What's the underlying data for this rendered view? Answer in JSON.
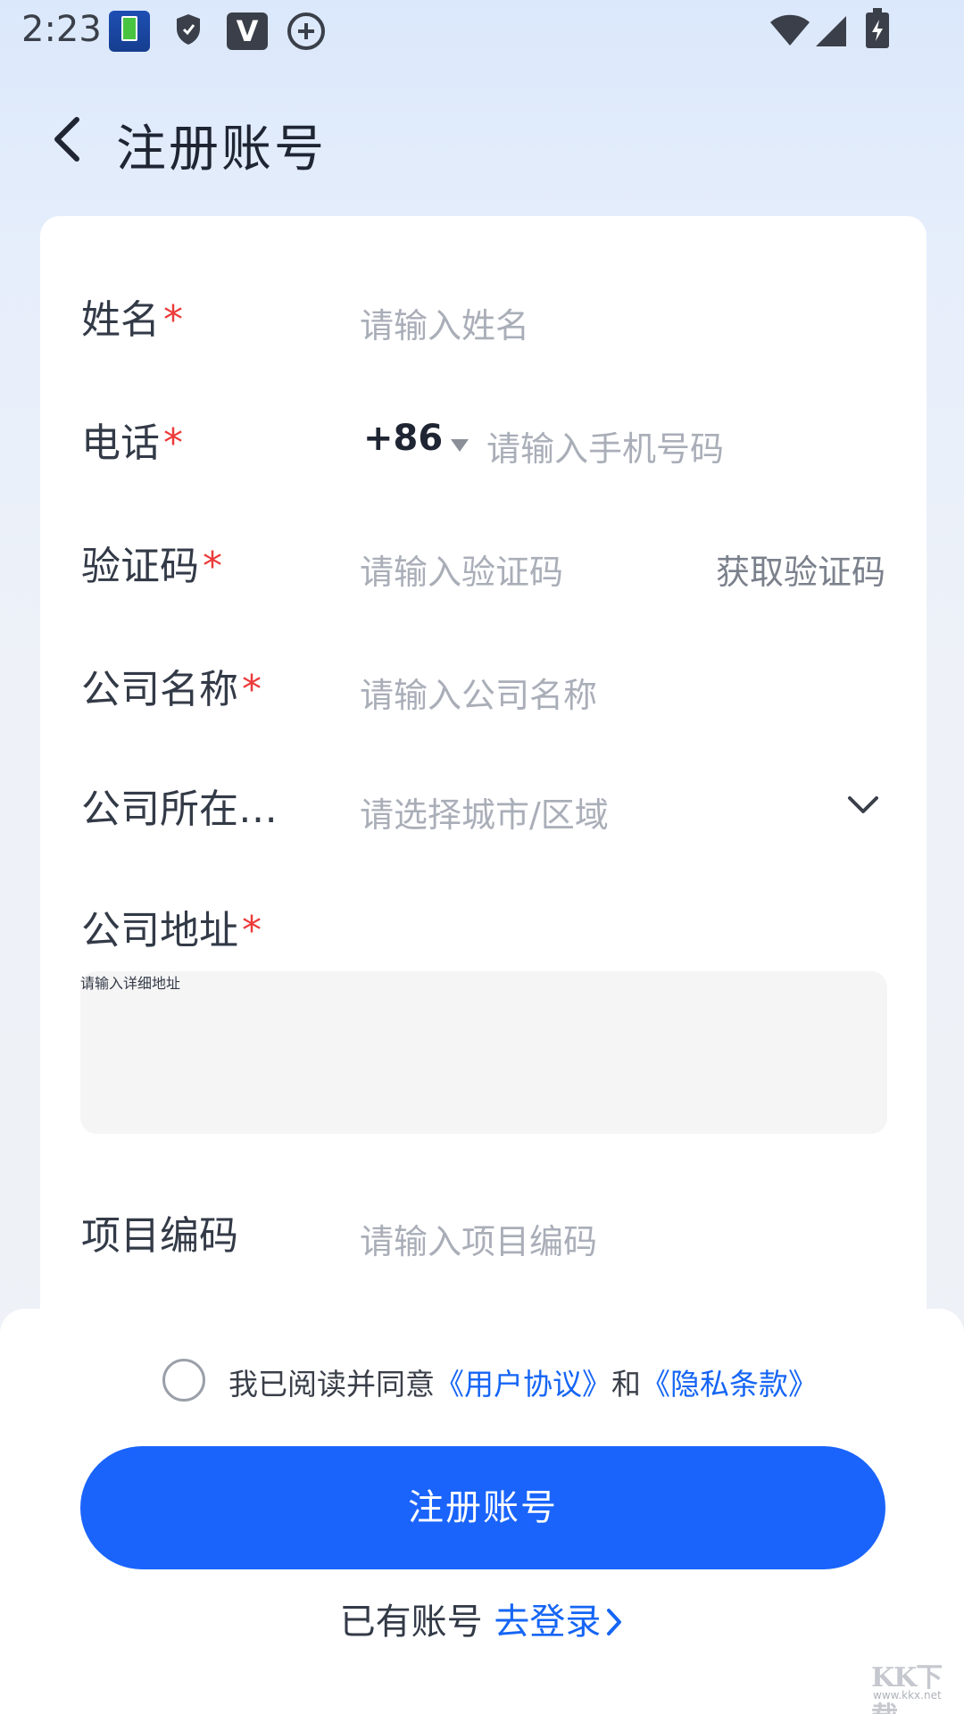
{
  "status_bar": {
    "time": "2:23",
    "icons": [
      "battery-app-icon",
      "shield-icon",
      "v-app-icon",
      "plus-circle-icon",
      "wifi-icon",
      "signal-icon",
      "battery-icon"
    ]
  },
  "header": {
    "title": "注册账号",
    "back_icon": "chevron-left-icon"
  },
  "form": {
    "name": {
      "label": "姓名",
      "required": "*",
      "placeholder": "请输入姓名"
    },
    "phone": {
      "label": "电话",
      "required": "*",
      "country_code": "+86",
      "placeholder": "请输入手机号码"
    },
    "code": {
      "label": "验证码",
      "required": "*",
      "placeholder": "请输入验证码",
      "action": "获取验证码"
    },
    "company": {
      "label": "公司名称",
      "required": "*",
      "placeholder": "请输入公司名称"
    },
    "city": {
      "label": "公司所在…",
      "placeholder": "请选择城市/区域"
    },
    "address": {
      "label": "公司地址",
      "required": "*",
      "placeholder": "请输入详细地址"
    },
    "project": {
      "label": "项目编码",
      "placeholder": "请输入项目编码"
    }
  },
  "agreement": {
    "prefix": "我已阅读并同意",
    "user_agreement": "《用户协议》",
    "and": "和",
    "privacy": "《隐私条款》"
  },
  "register_button": "注册账号",
  "login": {
    "prefix": "已有账号",
    "link": "去登录"
  },
  "watermark": {
    "text": "KK下载",
    "url": "www.kkx.net"
  },
  "colors": {
    "primary": "#1a64fc",
    "link": "#1565f5",
    "required": "#ec3a3a",
    "placeholder": "#a9aeb8"
  }
}
